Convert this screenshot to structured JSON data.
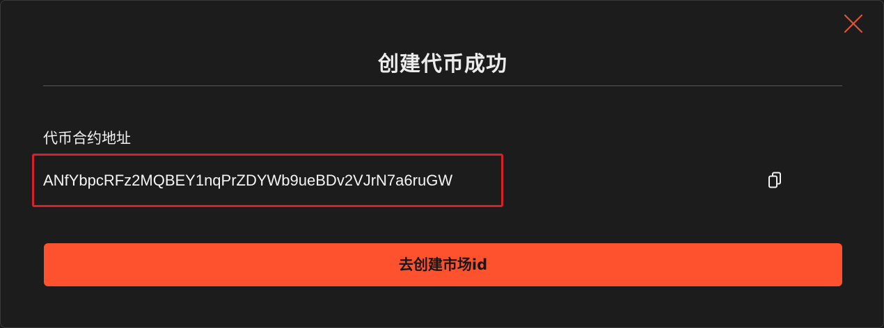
{
  "dialog": {
    "title": "创建代币成功",
    "field_label": "代币合约地址",
    "contract_address": "ANfYbpcRFz2MQBEY1nqPrZDYWb9ueBDv2VJrN7a6ruGW",
    "primary_button_label": "去创建市场id",
    "close_icon": "close-icon",
    "copy_icon": "copy-icon"
  },
  "colors": {
    "background": "#1c1c1c",
    "accent": "#fe522e",
    "highlight_border": "#d8202b",
    "close_icon": "#e0533b",
    "text": "#f2f2f2"
  }
}
